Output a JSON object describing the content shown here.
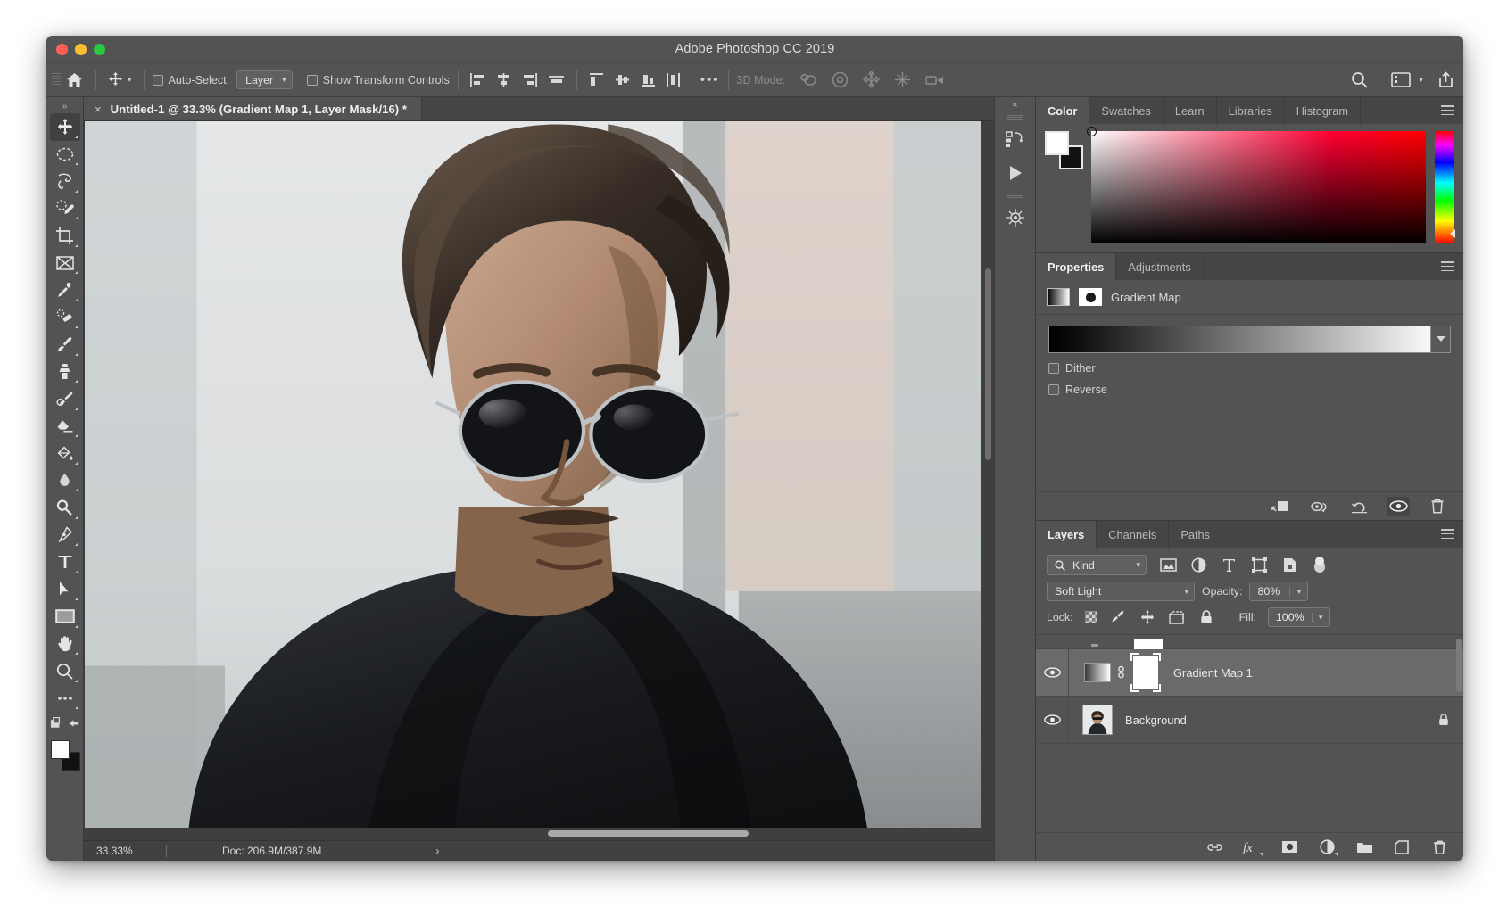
{
  "window": {
    "title": "Adobe Photoshop CC 2019",
    "traffic": [
      "close",
      "minimize",
      "maximize"
    ]
  },
  "options_bar": {
    "home_icon": "home-icon",
    "active_tool_icon": "move-tool-icon",
    "tool_chevron": "chevron-down-icon",
    "auto_select_label": "Auto-Select:",
    "auto_select_checked": false,
    "auto_select_scope": "Layer",
    "show_transform_label": "Show Transform Controls",
    "show_transform_checked": false,
    "align_icons": [
      "align-left-edges-icon",
      "align-horizontal-centers-icon",
      "align-right-edges-icon",
      "align-top-edges-icon"
    ],
    "distribute_icons": [
      "distribute-top-edges-icon",
      "distribute-vertical-centers-icon",
      "distribute-bottom-edges-icon",
      "distribute-horizontal-centers-icon"
    ],
    "more_label": "•••",
    "mode_3d_label": "3D Mode:",
    "mode_3d_icons": [
      "rotate-3d-icon",
      "roll-3d-icon",
      "pan-3d-icon",
      "slide-3d-icon",
      "scale-3d-icon"
    ],
    "right_icons": [
      "search-icon",
      "workspace-icon",
      "chevron-down-icon",
      "share-icon"
    ]
  },
  "tools": {
    "collapse_label": "»",
    "items": [
      {
        "name": "move-tool",
        "active": true
      },
      {
        "name": "elliptical-marquee-tool",
        "active": false
      },
      {
        "name": "lasso-tool",
        "active": false
      },
      {
        "name": "quick-selection-tool",
        "active": false
      },
      {
        "name": "crop-tool",
        "active": false
      },
      {
        "name": "frame-tool",
        "active": false
      },
      {
        "name": "eyedropper-tool",
        "active": false
      },
      {
        "name": "spot-healing-brush-tool",
        "active": false
      },
      {
        "name": "brush-tool",
        "active": false
      },
      {
        "name": "clone-stamp-tool",
        "active": false
      },
      {
        "name": "history-brush-tool",
        "active": false
      },
      {
        "name": "eraser-tool",
        "active": false
      },
      {
        "name": "gradient-tool",
        "active": false
      },
      {
        "name": "blur-tool",
        "active": false
      },
      {
        "name": "dodge-tool",
        "active": false
      },
      {
        "name": "pen-tool",
        "active": false
      },
      {
        "name": "type-tool",
        "active": false
      },
      {
        "name": "path-selection-tool",
        "active": false
      },
      {
        "name": "rectangle-tool",
        "active": false
      },
      {
        "name": "hand-tool",
        "active": false
      },
      {
        "name": "zoom-tool",
        "active": false
      },
      {
        "name": "edit-toolbar-tool",
        "active": false
      }
    ],
    "foreground_color": "#ffffff",
    "background_color": "#111111"
  },
  "document": {
    "tab_title": "Untitled-1 @ 33.3% (Gradient Map 1, Layer Mask/16) *",
    "close_glyph": "×"
  },
  "status_bar": {
    "zoom": "33.33%",
    "doc": "Doc: 206.9M/387.9M",
    "arrow": "›"
  },
  "right_rail": {
    "collapse_label": "«",
    "icons": [
      "history-states-icon",
      "play-action-icon",
      "3d-properties-icon"
    ]
  },
  "color_panel": {
    "tabs": [
      {
        "label": "Color",
        "active": true
      },
      {
        "label": "Swatches",
        "active": false
      },
      {
        "label": "Learn",
        "active": false
      },
      {
        "label": "Libraries",
        "active": false
      },
      {
        "label": "Histogram",
        "active": false
      }
    ],
    "foreground": "#ffffff",
    "background": "#111111",
    "menu_icon": "panel-menu-icon"
  },
  "properties_panel": {
    "tabs": [
      {
        "label": "Properties",
        "active": true
      },
      {
        "label": "Adjustments",
        "active": false
      }
    ],
    "adjustment_name": "Gradient Map",
    "gradient_thumb_icon": "gradient-thumbnail-icon",
    "mask_thumb_icon": "layer-mask-thumbnail-icon",
    "gradient_from": "#000000",
    "gradient_to": "#ffffff",
    "gradient_dropdown_icon": "chevron-down-icon",
    "dither_label": "Dither",
    "dither_checked": false,
    "reverse_label": "Reverse",
    "reverse_checked": false,
    "footer_icons": [
      "clip-to-layer-icon",
      "toggle-previous-state-icon",
      "reset-adjustment-icon",
      "toggle-visibility-icon",
      "delete-adjustment-icon"
    ],
    "menu_icon": "panel-menu-icon"
  },
  "layers_panel": {
    "tabs": [
      {
        "label": "Layers",
        "active": true
      },
      {
        "label": "Channels",
        "active": false
      },
      {
        "label": "Paths",
        "active": false
      }
    ],
    "menu_icon": "panel-menu-icon",
    "filter": {
      "search_icon": "search-icon",
      "kind_label": "Kind",
      "chevron": "chevron-down-icon",
      "type_icons": [
        "filter-pixel-icon",
        "filter-adjustment-icon",
        "filter-type-icon",
        "filter-shape-icon",
        "filter-smart-object-icon",
        "filter-toggle-icon"
      ]
    },
    "blend_mode": "Soft Light",
    "blend_chevron": "chevron-down-icon",
    "opacity_label": "Opacity:",
    "opacity_value": "80%",
    "lock_label": "Lock:",
    "lock_icons": [
      "lock-transparent-pixels-icon",
      "lock-image-pixels-icon",
      "lock-position-icon",
      "lock-artboard-nesting-icon",
      "lock-all-icon"
    ],
    "fill_label": "Fill:",
    "fill_value": "100%",
    "rows": [
      {
        "name": "Gradient Map 1",
        "visible": true,
        "selected": true,
        "has_mask": true,
        "linked": true,
        "thumb": "gradient-map-thumbnail",
        "locked": false
      },
      {
        "name": "Background",
        "visible": true,
        "selected": false,
        "has_mask": false,
        "linked": false,
        "thumb": "photo-thumbnail",
        "locked": true
      }
    ],
    "footer_icons": [
      "link-layers-icon",
      "layer-styles-fx-icon",
      "add-layer-mask-icon",
      "new-adjustment-layer-icon",
      "new-group-icon",
      "new-layer-icon",
      "delete-layer-icon"
    ]
  }
}
